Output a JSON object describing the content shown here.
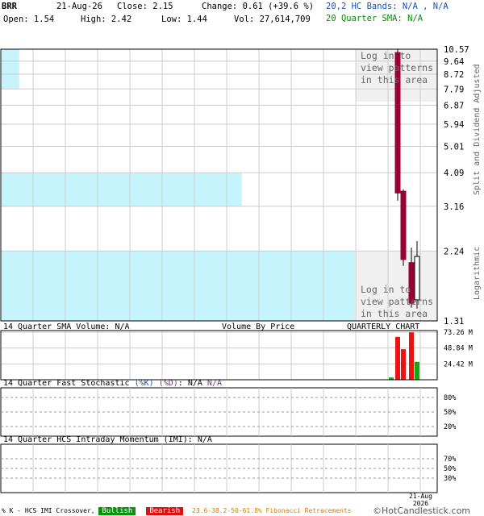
{
  "header": {
    "ticker": "BRR",
    "date": "21-Aug-26",
    "close_label": "Close: 2.15",
    "change_label": "Change: 0.61 (+39.6 %)",
    "open_label": "Open: 1.54",
    "high_label": "High: 2.42",
    "low_label": "Low: 1.44",
    "vol_label": "Vol: 27,614,709",
    "bands_label": "20,2 HC Bands: N/A , N/A",
    "sma_label": "20 Quarter SMA: N/A"
  },
  "price_panel": {
    "login_note_top": [
      "Log in to",
      "view patterns",
      "in this area"
    ],
    "login_note_bottom": [
      "Log in to",
      "view patterns",
      "in this area"
    ],
    "right_label_top": "Split and Dividend Adjusted",
    "right_label_bottom": "Logarithmic"
  },
  "volume_panel": {
    "label_left": "14 Quarter SMA Volume: N/A",
    "label_mid": "Volume By Price",
    "label_right": "QUARTERLY CHART"
  },
  "stoch_panel": {
    "label": "14 Quarter Fast Stochastic ",
    "k": "(%K)",
    "d": "(%D)",
    "colon": ":",
    "v1": " N/A",
    "v2": "  N/A"
  },
  "imi_panel": {
    "label": "14 Quarter HCS Intraday Momentum (IMI): N/A"
  },
  "x_axis": {
    "last_label_top": "21-Aug",
    "last_label_bottom": "2026"
  },
  "footer": {
    "legend_prefix": "% K - HCS IMI Crossover,",
    "bullish": "Bullish",
    "bearish": "Bearish",
    "fib": "23.6-38.2-50-61.8% Fibonacci Retracements",
    "copyright": "©HotCandlestick.com"
  },
  "colors": {
    "up": "#ffffff",
    "down": "#990033",
    "vbp": "#c6f4fd",
    "vol_up": "#11aa11",
    "vol_down": "#ee1111",
    "bullish_bg": "#109010",
    "bearish_bg": "#dd1111",
    "fib_text": "#d87a00"
  },
  "chart_data": [
    {
      "type": "candlestick",
      "scale": "log",
      "y_ticks": [
        10.57,
        9.64,
        8.72,
        7.79,
        6.87,
        5.94,
        5.01,
        4.09,
        3.16,
        2.24,
        1.31
      ],
      "ylim": [
        1.31,
        10.57
      ],
      "candles": [
        {
          "open": 10.3,
          "high": 10.6,
          "low": 3.3,
          "close": 3.5,
          "dir": "down"
        },
        {
          "open": 3.55,
          "high": 3.6,
          "low": 2.0,
          "close": 2.1,
          "dir": "down"
        },
        {
          "open": 2.05,
          "high": 2.3,
          "low": 1.45,
          "close": 1.5,
          "dir": "down"
        },
        {
          "open": 1.54,
          "high": 2.42,
          "low": 1.44,
          "close": 2.15,
          "dir": "up"
        }
      ],
      "volume_by_price": [
        {
          "low": 7.79,
          "high": 10.57,
          "relative": 0.05
        },
        {
          "low": 3.16,
          "high": 4.09,
          "relative": 0.68
        },
        {
          "low": 1.31,
          "high": 2.24,
          "relative": 1.0
        }
      ]
    },
    {
      "type": "bar",
      "title": "volume",
      "y_ticks": [
        "73.26 M",
        "48.84 M",
        "24.42 M"
      ],
      "ylim": [
        0,
        73.26
      ],
      "bars": [
        {
          "value": 3.5,
          "dir": "up"
        },
        {
          "value": 66,
          "dir": "down"
        },
        {
          "value": 47,
          "dir": "down"
        },
        {
          "value": 73,
          "dir": "down"
        },
        {
          "value": 27.6,
          "dir": "up"
        }
      ]
    },
    {
      "type": "line",
      "title": "stochastic",
      "y_ticks": [
        "80%",
        "50%",
        "20%"
      ],
      "ylim": [
        0,
        100
      ]
    },
    {
      "type": "line",
      "title": "imi",
      "y_ticks": [
        "70%",
        "50%",
        "30%"
      ],
      "ylim": [
        0,
        100
      ]
    }
  ]
}
